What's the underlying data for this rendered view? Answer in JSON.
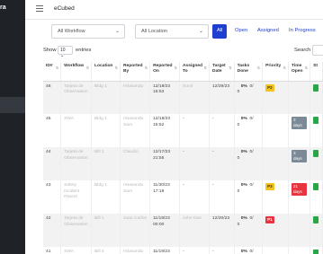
{
  "sidebar": {
    "brand": "ra"
  },
  "header": {
    "title": "eCubed"
  },
  "filters": {
    "workflow": "All Workflow",
    "location": "All Location",
    "tabs": [
      {
        "label": "All",
        "active": true
      },
      {
        "label": "Open",
        "active": false
      },
      {
        "label": "Assigned",
        "active": false
      },
      {
        "label": "In Progress",
        "active": false
      }
    ]
  },
  "controls": {
    "show": "Show",
    "length": "10",
    "entries": "entries",
    "search": "Search"
  },
  "table": {
    "columns": [
      "ID#",
      "Workflow",
      "Location",
      "Reported By",
      "Reported On",
      "Assigned To",
      "Target Date",
      "Tasks Done",
      "Priority",
      "Time Open",
      "St"
    ],
    "rows": [
      {
        "id": "46",
        "workflow": "Tarjeta de Observation",
        "location": "Bldg 1",
        "reported_by": "Hirasandu",
        "reported_on": "12/18/23 15:53",
        "assigned_to": "Sunil",
        "target_date": "12/29/23",
        "pct": "0%",
        "ratio": "0/",
        "tasks_tail": "0",
        "priority": "P2",
        "time_open": ""
      },
      {
        "id": "45",
        "workflow": "SWA",
        "location": "Bldg 1",
        "reported_by": "Hirasandu Sam",
        "reported_on": "12/18/23 15:52",
        "assigned_to": "-",
        "target_date": "-",
        "pct": "0%",
        "ratio": "0/",
        "tasks_tail": "0",
        "priority": "",
        "time_open": "3 days"
      },
      {
        "id": "44",
        "workflow": "Tarjeta de Observation",
        "location": "Bill 1",
        "reported_by": "Claudio",
        "reported_on": "12/17/23 21:55",
        "assigned_to": "-",
        "target_date": "-",
        "pct": "0%",
        "ratio": "0/",
        "tasks_tail": "0",
        "priority": "",
        "time_open": "3 days"
      },
      {
        "id": "43",
        "workflow": "Safety Incident Report",
        "location": "Bldg 1",
        "reported_by": "Hirasandu Sam",
        "reported_on": "11/30/23 17:18",
        "assigned_to": "-",
        "target_date": "-",
        "pct": "0%",
        "ratio": "0/",
        "tasks_tail": "0",
        "priority": "P3",
        "time_open": "21 days"
      },
      {
        "id": "42",
        "workflow": "Tarjeta de Observation",
        "location": "Bill 1",
        "reported_by": "Juan Carlos",
        "reported_on": "11/19/23 00:00",
        "assigned_to": "John Doe",
        "target_date": "12/20/23",
        "pct": "0%",
        "ratio": "0/",
        "tasks_tail": "0",
        "priority": "P1",
        "time_open": ""
      },
      {
        "id": "41",
        "workflow": "SWA",
        "location": "Bill 4",
        "reported_by": "Hirasandu",
        "reported_on": "11/19/23",
        "assigned_to": "-",
        "target_date": "-",
        "pct": "0%",
        "ratio": "0/",
        "tasks_tail": "",
        "priority": "",
        "time_open": ""
      }
    ]
  },
  "colors": {
    "accent": "#1f3fd1",
    "sidebar": "#1f2227",
    "p1": "#e8343f",
    "p2": "#f3c21b",
    "status": "#28a745"
  }
}
